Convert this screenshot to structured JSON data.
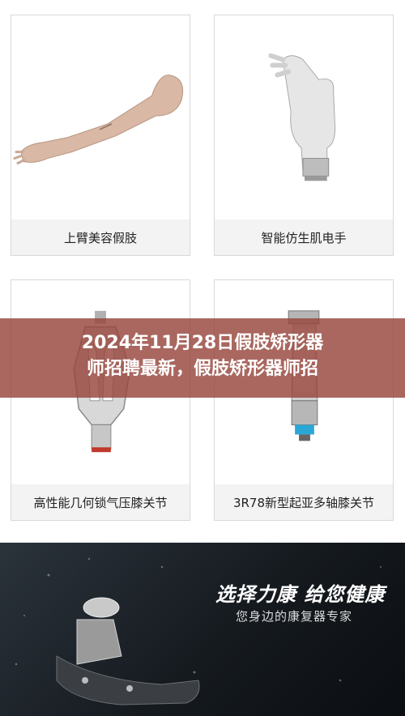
{
  "products": [
    {
      "caption": "上臂美容假肢",
      "icon": "cosmetic-arm"
    },
    {
      "caption": "智能仿生肌电手",
      "icon": "bionic-hand"
    },
    {
      "caption": "高性能几何锁气压膝关节",
      "icon": "pneumatic-knee"
    },
    {
      "caption": "3R78新型起亚多轴膝关节",
      "icon": "polycentric-knee"
    }
  ],
  "overlay": {
    "line1": "2024年11月28日假肢矫形器",
    "line2": "师招聘最新，假肢矫形器师招"
  },
  "banner": {
    "slogan": "选择力康 给您健康",
    "subtitle": "您身边的康复器专家"
  }
}
